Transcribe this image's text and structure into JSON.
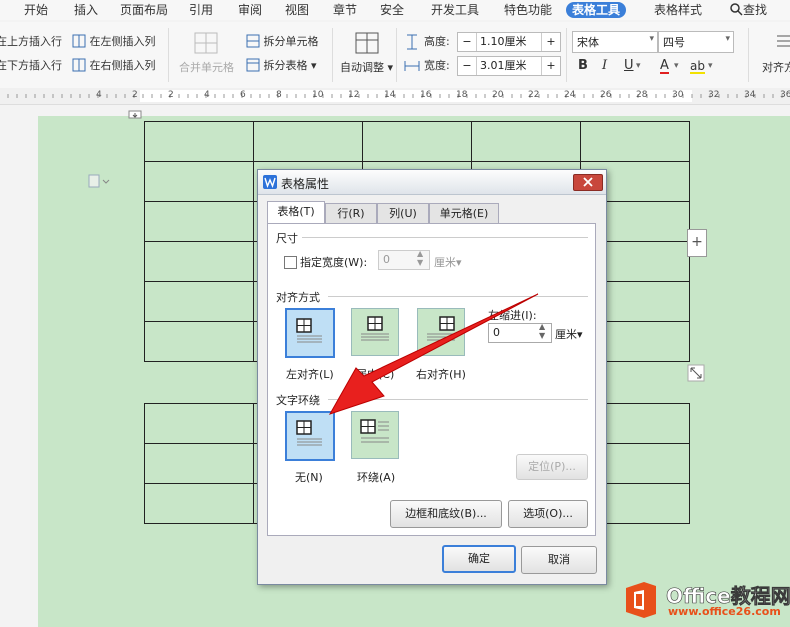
{
  "menu": {
    "items": [
      "开始",
      "插入",
      "页面布局",
      "引用",
      "审阅",
      "视图",
      "章节",
      "安全",
      "开发工具",
      "特色功能",
      "表格工具",
      "表格样式"
    ],
    "search": "查找",
    "accent": "#3b7fd9"
  },
  "ribbon": {
    "insert_above": "在上方插入行",
    "insert_below": "在下方插入行",
    "insert_left": "在左侧插入列",
    "insert_right": "在右侧插入列",
    "merge_cells": "合并单元格",
    "split_cells": "拆分单元格",
    "split_table": "拆分表格",
    "auto_fit": "自动调整",
    "height_label": "高度:",
    "height_value": "1.10厘米",
    "width_label": "宽度:",
    "width_value": "3.01厘米",
    "font_name": "宋体",
    "font_size": "四号",
    "align_label": "对齐方",
    "bold": "B",
    "italic": "I",
    "underline": "U",
    "font_color": "A",
    "highlight": "ab"
  },
  "ruler": {
    "marks": [
      "4",
      "2",
      "2",
      "4",
      "6",
      "8",
      "10",
      "12",
      "14",
      "16",
      "18",
      "20",
      "22",
      "24",
      "26",
      "28",
      "30",
      "32",
      "34",
      "36"
    ]
  },
  "dialog": {
    "title": "表格属性",
    "tabs": [
      "表格(T)",
      "行(R)",
      "列(U)",
      "单元格(E)"
    ],
    "size_section": "尺寸",
    "specify_width": "指定宽度(W):",
    "width_value": "0",
    "width_unit": "厘米",
    "align_section": "对齐方式",
    "align_left": "左对齐(L)",
    "align_center": "居中(C)",
    "align_right": "右对齐(H)",
    "indent_label": "左缩进(I):",
    "indent_value": "0",
    "indent_unit": "厘米",
    "wrap_section": "文字环绕",
    "wrap_none": "无(N)",
    "wrap_around": "环绕(A)",
    "position_button": "定位(P)...",
    "borders_button": "边框和底纹(B)...",
    "options_button": "选项(O)...",
    "ok_button": "确定",
    "cancel_button": "取消"
  },
  "watermark": {
    "brand": "Office教程网",
    "url": "www.office26.com"
  },
  "colors": {
    "page_green": "#c8e6c8",
    "arrow_red": "#e8201e",
    "brand_orange": "#e8501a"
  }
}
